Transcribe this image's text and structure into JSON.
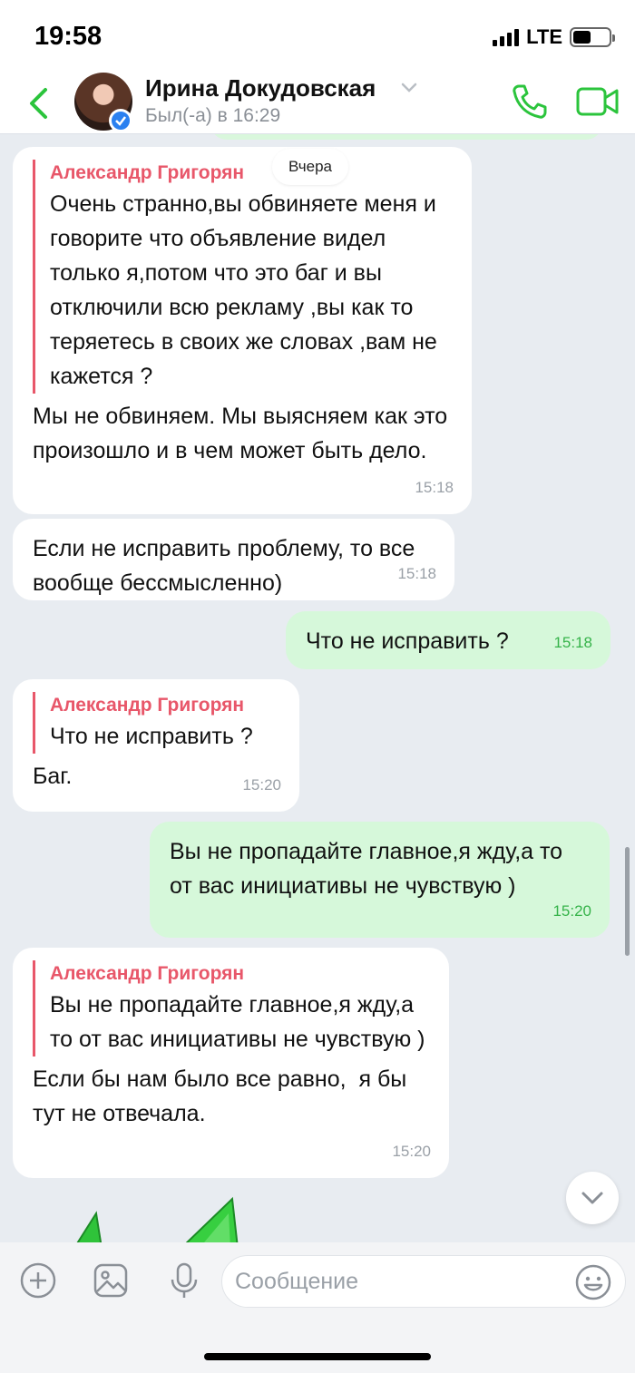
{
  "status_bar": {
    "time": "19:58",
    "network": "LTE",
    "battery_level": 0.5
  },
  "header": {
    "contact_name": "Ирина Докудовская",
    "last_seen": "Был(-а) в 16:29",
    "accent_color": "#2bc43c"
  },
  "chat": {
    "date_label": "Вчера",
    "messages": [
      {
        "direction": "in",
        "quote_author": "Александр Григорян",
        "quote_text": "Очень странно,вы обвиняете меня и говорите что объявление видел только я,потом что это баг и вы отключили всю рекламу ,вы как то теряетесь в своих же словах ,вам не кажется ?",
        "text": "Мы не обвиняем. Мы выясняем как это произошло и в чем может быть дело.",
        "time": "15:18"
      },
      {
        "direction": "in",
        "text": "Если не исправить проблему, то все вообще бессмысленно)",
        "time": "15:18"
      },
      {
        "direction": "out",
        "text": "Что не исправить ?",
        "time": "15:18"
      },
      {
        "direction": "in",
        "quote_author": "Александр Григорян",
        "quote_text": "Что не исправить ?",
        "text": "Баг.",
        "time": "15:20"
      },
      {
        "direction": "out",
        "text": "Вы не пропадайте главное,я жду,а то от вас инициативы не чувствую )",
        "time": "15:20"
      },
      {
        "direction": "in",
        "quote_author": "Александр Григорян",
        "quote_text": "Вы не пропадайте главное,я жду,а то от вас инициативы не чувствую )",
        "text": "Если бы нам было все равно,  я бы тут не отвечала.",
        "time": "15:20"
      }
    ]
  },
  "composer": {
    "placeholder": "Сообщение"
  },
  "icons": {
    "back": "chevron-left-icon",
    "call": "phone-icon",
    "video": "video-camera-icon",
    "add": "plus-circle-icon",
    "gallery": "image-icon",
    "mic": "microphone-icon",
    "emoji": "smile-icon",
    "scroll": "chevron-down-icon"
  }
}
